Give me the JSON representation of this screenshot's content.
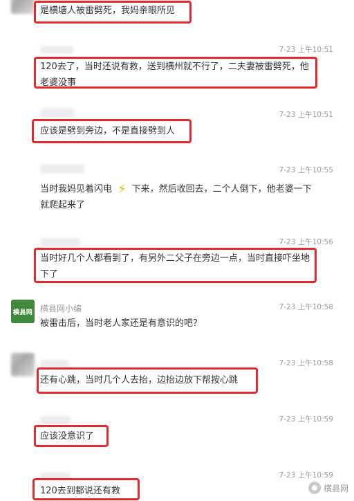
{
  "comments": [
    {
      "text": "是横塘人被雷劈死，我妈亲眼所见"
    },
    {
      "time": "7-23 上午10:51",
      "text": "120去了，当时还说有救，送到横州就不行了，二夫妻被雷劈死，他老婆没事"
    },
    {
      "time": "7-23 上午10:51",
      "text": "应该是劈到旁边，不是直接劈到人"
    },
    {
      "time": "7-23 上午10:55",
      "text_before": "当时我妈见着闪电",
      "text_after": "下来，然后收回去，二个人倒下，他老婆一下就爬起来了",
      "icon": "lightning-icon"
    },
    {
      "time": "7-23 上午10:56",
      "text": "当时好几个人都看到了，有另外二父子在旁边一点，当时直接吓坐地下了"
    },
    {
      "time": "7-23 上午10:58",
      "nickname": "横县网小编",
      "avatar_text": "横县网",
      "text": "被雷击后，当时老人家还是有意识的吧？"
    },
    {
      "time": "7-23 上午10:58",
      "text": "还有心跳，当时几个人去抬，边抬边放下帮按心跳"
    },
    {
      "time": "7-23 上午10:59",
      "text": "应该没意识了"
    },
    {
      "time": "7-23 上午10:59",
      "text": "120去到都说还有救"
    }
  ],
  "watermark": {
    "text": "横县网",
    "icon": "wechat-account-icon"
  },
  "colors": {
    "highlight": "#e32a2a",
    "brand_avatar": "#3f8a3a",
    "meta_text": "#9a9a9a",
    "body_text": "#333333"
  }
}
